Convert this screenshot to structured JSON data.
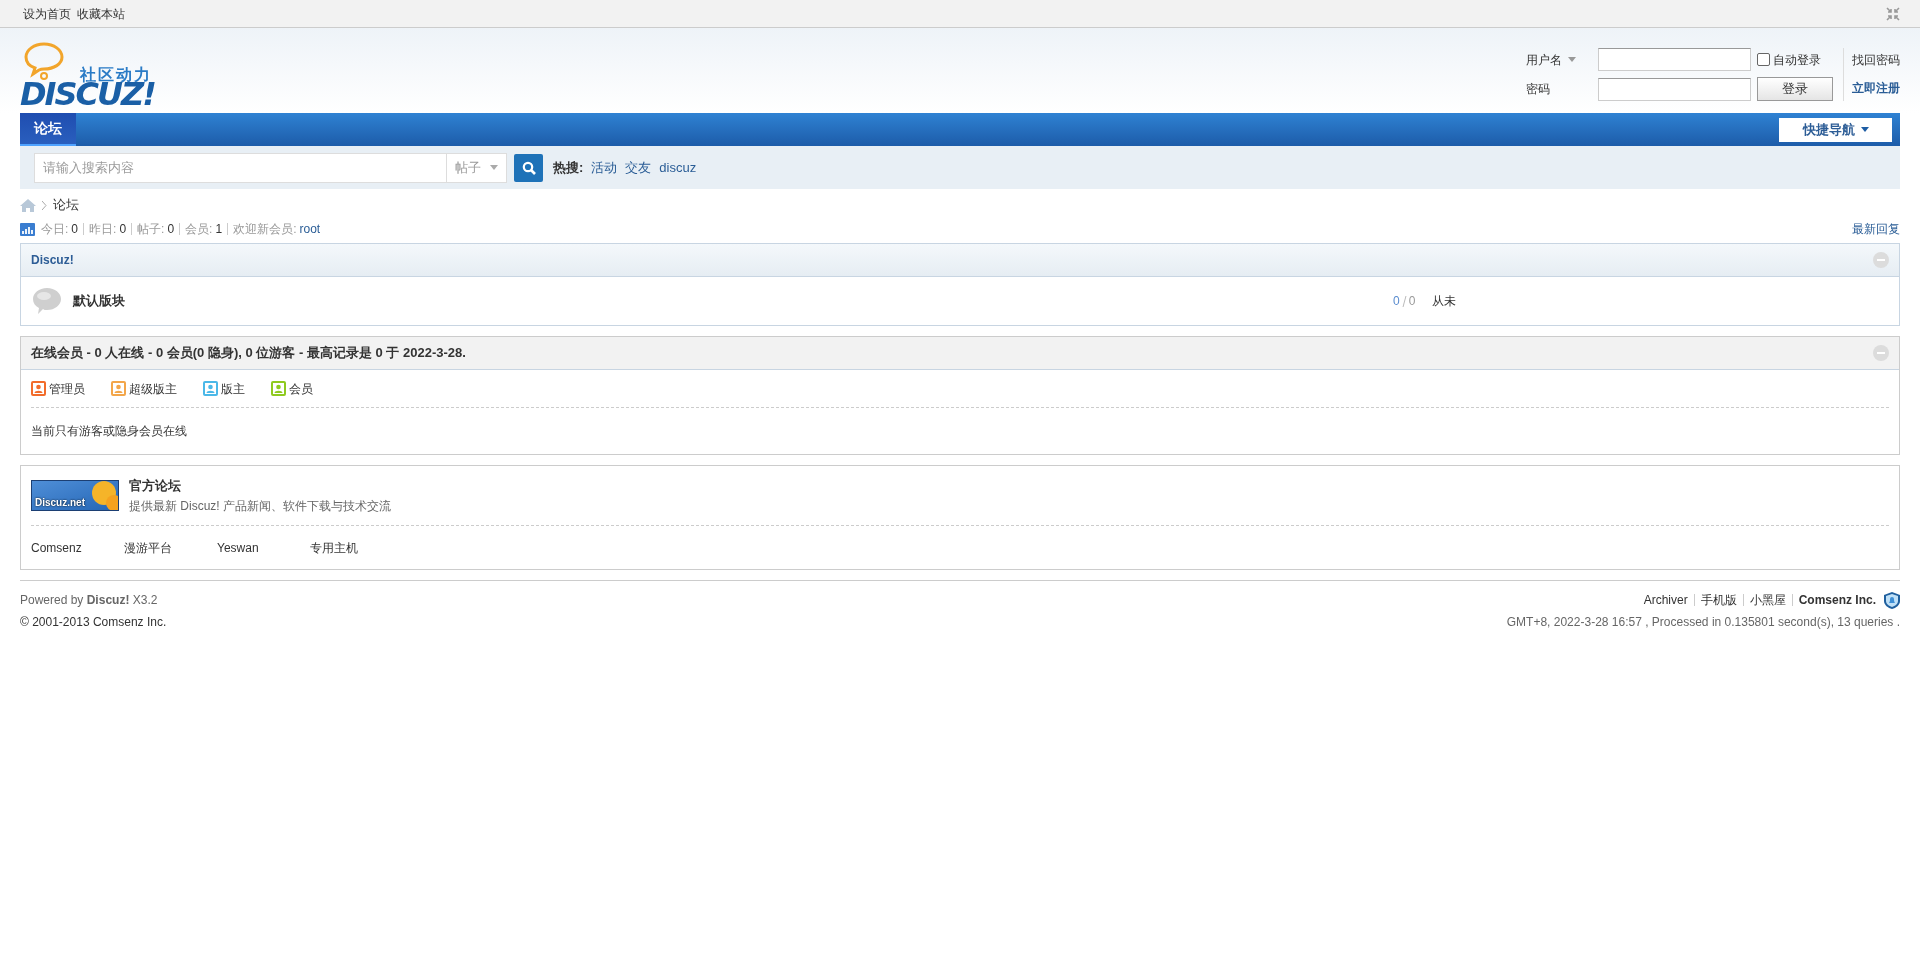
{
  "top_links": [
    "设为首页",
    "收藏本站"
  ],
  "logo": {
    "tagline": "社区动力",
    "wordmark": "DISCUZ!"
  },
  "login": {
    "username_label": "用户名",
    "password_label": "密码",
    "auto_login": {
      "label": "自动登录",
      "checked": false
    },
    "login_button": "登录",
    "links": [
      {
        "label": "找回密码",
        "bold": false
      },
      {
        "label": "立即注册",
        "bold": true
      }
    ]
  },
  "nav": {
    "tabs": [
      {
        "label": "论坛",
        "selected": true
      }
    ],
    "quick_nav": "快捷导航"
  },
  "search": {
    "placeholder": "请输入搜索内容",
    "scope": "帖子",
    "hot_label": "热搜:",
    "hot_terms": [
      "活动",
      "交友",
      "discuz"
    ]
  },
  "breadcrumb": [
    "论坛"
  ],
  "stats": [
    {
      "label": "今日:",
      "value": "0",
      "kind": "count"
    },
    {
      "label": "昨日:",
      "value": "0",
      "kind": "count"
    },
    {
      "label": "帖子:",
      "value": "0",
      "kind": "count"
    },
    {
      "label": "会员:",
      "value": "1",
      "kind": "count"
    },
    {
      "label": "欢迎新会员:",
      "value": "root",
      "kind": "member"
    }
  ],
  "latest_replies": "最新回复",
  "forum_category": {
    "title": "Discuz!",
    "forums": [
      {
        "name": "默认版块",
        "threads": "0",
        "posts": "0",
        "last_post": "从未"
      }
    ]
  },
  "online": {
    "title": "在线会员 - 0 人在线 - 0 会员(0 隐身), 0 位游客 - 最高记录是 0 于 2022-3-28.",
    "legend": [
      {
        "label": "管理员",
        "color": "#f26c2b"
      },
      {
        "label": "超级版主",
        "color": "#f3a64a"
      },
      {
        "label": "版主",
        "color": "#4bb8e8"
      },
      {
        "label": "会员",
        "color": "#8fca1f"
      }
    ],
    "message": "当前只有游客或隐身会员在线"
  },
  "links": {
    "featured": {
      "badge": "Discuz.net",
      "title": "官方论坛",
      "description": "提供最新 Discuz! 产品新闻、软件下载与技术交流"
    },
    "text_links": [
      "Comsenz",
      "漫游平台",
      "Yeswan",
      "专用主机"
    ]
  },
  "footer": {
    "powered": "Powered by **Discuz!** X3.2",
    "copyright": "© 2001-2013 Comsenz Inc.",
    "links": [
      {
        "label": "Archiver",
        "bold": false
      },
      {
        "label": "手机版",
        "bold": false
      },
      {
        "label": "小黑屋",
        "bold": false
      },
      {
        "label": "Comsenz Inc.",
        "bold": true
      }
    ],
    "info": "GMT+8, 2022-3-28 16:57 , Processed in 0.135801 second(s), 13 queries ."
  }
}
